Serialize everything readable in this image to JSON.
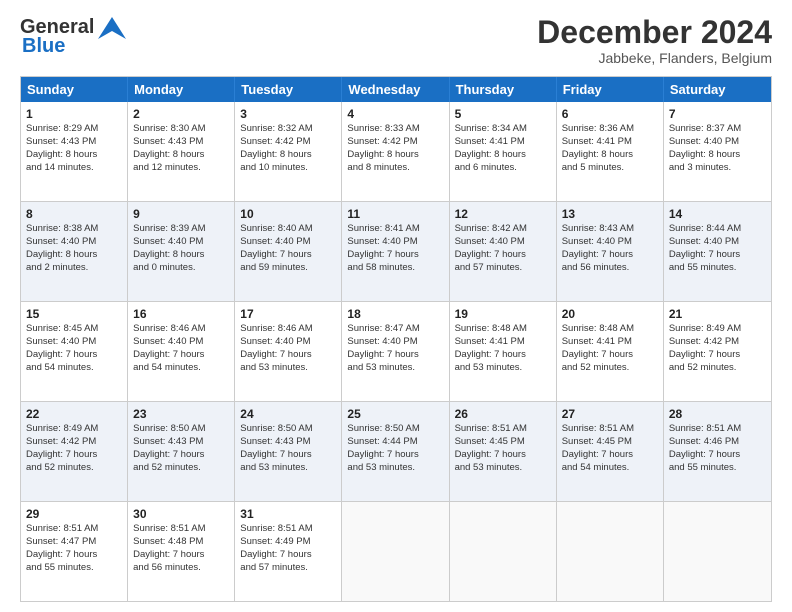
{
  "logo": {
    "line1": "General",
    "line2": "Blue"
  },
  "title": "December 2024",
  "subtitle": "Jabbeke, Flanders, Belgium",
  "days": [
    "Sunday",
    "Monday",
    "Tuesday",
    "Wednesday",
    "Thursday",
    "Friday",
    "Saturday"
  ],
  "weeks": [
    [
      {
        "num": "1",
        "lines": [
          "Sunrise: 8:29 AM",
          "Sunset: 4:43 PM",
          "Daylight: 8 hours",
          "and 14 minutes."
        ]
      },
      {
        "num": "2",
        "lines": [
          "Sunrise: 8:30 AM",
          "Sunset: 4:43 PM",
          "Daylight: 8 hours",
          "and 12 minutes."
        ]
      },
      {
        "num": "3",
        "lines": [
          "Sunrise: 8:32 AM",
          "Sunset: 4:42 PM",
          "Daylight: 8 hours",
          "and 10 minutes."
        ]
      },
      {
        "num": "4",
        "lines": [
          "Sunrise: 8:33 AM",
          "Sunset: 4:42 PM",
          "Daylight: 8 hours",
          "and 8 minutes."
        ]
      },
      {
        "num": "5",
        "lines": [
          "Sunrise: 8:34 AM",
          "Sunset: 4:41 PM",
          "Daylight: 8 hours",
          "and 6 minutes."
        ]
      },
      {
        "num": "6",
        "lines": [
          "Sunrise: 8:36 AM",
          "Sunset: 4:41 PM",
          "Daylight: 8 hours",
          "and 5 minutes."
        ]
      },
      {
        "num": "7",
        "lines": [
          "Sunrise: 8:37 AM",
          "Sunset: 4:40 PM",
          "Daylight: 8 hours",
          "and 3 minutes."
        ]
      }
    ],
    [
      {
        "num": "8",
        "lines": [
          "Sunrise: 8:38 AM",
          "Sunset: 4:40 PM",
          "Daylight: 8 hours",
          "and 2 minutes."
        ]
      },
      {
        "num": "9",
        "lines": [
          "Sunrise: 8:39 AM",
          "Sunset: 4:40 PM",
          "Daylight: 8 hours",
          "and 0 minutes."
        ]
      },
      {
        "num": "10",
        "lines": [
          "Sunrise: 8:40 AM",
          "Sunset: 4:40 PM",
          "Daylight: 7 hours",
          "and 59 minutes."
        ]
      },
      {
        "num": "11",
        "lines": [
          "Sunrise: 8:41 AM",
          "Sunset: 4:40 PM",
          "Daylight: 7 hours",
          "and 58 minutes."
        ]
      },
      {
        "num": "12",
        "lines": [
          "Sunrise: 8:42 AM",
          "Sunset: 4:40 PM",
          "Daylight: 7 hours",
          "and 57 minutes."
        ]
      },
      {
        "num": "13",
        "lines": [
          "Sunrise: 8:43 AM",
          "Sunset: 4:40 PM",
          "Daylight: 7 hours",
          "and 56 minutes."
        ]
      },
      {
        "num": "14",
        "lines": [
          "Sunrise: 8:44 AM",
          "Sunset: 4:40 PM",
          "Daylight: 7 hours",
          "and 55 minutes."
        ]
      }
    ],
    [
      {
        "num": "15",
        "lines": [
          "Sunrise: 8:45 AM",
          "Sunset: 4:40 PM",
          "Daylight: 7 hours",
          "and 54 minutes."
        ]
      },
      {
        "num": "16",
        "lines": [
          "Sunrise: 8:46 AM",
          "Sunset: 4:40 PM",
          "Daylight: 7 hours",
          "and 54 minutes."
        ]
      },
      {
        "num": "17",
        "lines": [
          "Sunrise: 8:46 AM",
          "Sunset: 4:40 PM",
          "Daylight: 7 hours",
          "and 53 minutes."
        ]
      },
      {
        "num": "18",
        "lines": [
          "Sunrise: 8:47 AM",
          "Sunset: 4:40 PM",
          "Daylight: 7 hours",
          "and 53 minutes."
        ]
      },
      {
        "num": "19",
        "lines": [
          "Sunrise: 8:48 AM",
          "Sunset: 4:41 PM",
          "Daylight: 7 hours",
          "and 53 minutes."
        ]
      },
      {
        "num": "20",
        "lines": [
          "Sunrise: 8:48 AM",
          "Sunset: 4:41 PM",
          "Daylight: 7 hours",
          "and 52 minutes."
        ]
      },
      {
        "num": "21",
        "lines": [
          "Sunrise: 8:49 AM",
          "Sunset: 4:42 PM",
          "Daylight: 7 hours",
          "and 52 minutes."
        ]
      }
    ],
    [
      {
        "num": "22",
        "lines": [
          "Sunrise: 8:49 AM",
          "Sunset: 4:42 PM",
          "Daylight: 7 hours",
          "and 52 minutes."
        ]
      },
      {
        "num": "23",
        "lines": [
          "Sunrise: 8:50 AM",
          "Sunset: 4:43 PM",
          "Daylight: 7 hours",
          "and 52 minutes."
        ]
      },
      {
        "num": "24",
        "lines": [
          "Sunrise: 8:50 AM",
          "Sunset: 4:43 PM",
          "Daylight: 7 hours",
          "and 53 minutes."
        ]
      },
      {
        "num": "25",
        "lines": [
          "Sunrise: 8:50 AM",
          "Sunset: 4:44 PM",
          "Daylight: 7 hours",
          "and 53 minutes."
        ]
      },
      {
        "num": "26",
        "lines": [
          "Sunrise: 8:51 AM",
          "Sunset: 4:45 PM",
          "Daylight: 7 hours",
          "and 53 minutes."
        ]
      },
      {
        "num": "27",
        "lines": [
          "Sunrise: 8:51 AM",
          "Sunset: 4:45 PM",
          "Daylight: 7 hours",
          "and 54 minutes."
        ]
      },
      {
        "num": "28",
        "lines": [
          "Sunrise: 8:51 AM",
          "Sunset: 4:46 PM",
          "Daylight: 7 hours",
          "and 55 minutes."
        ]
      }
    ],
    [
      {
        "num": "29",
        "lines": [
          "Sunrise: 8:51 AM",
          "Sunset: 4:47 PM",
          "Daylight: 7 hours",
          "and 55 minutes."
        ]
      },
      {
        "num": "30",
        "lines": [
          "Sunrise: 8:51 AM",
          "Sunset: 4:48 PM",
          "Daylight: 7 hours",
          "and 56 minutes."
        ]
      },
      {
        "num": "31",
        "lines": [
          "Sunrise: 8:51 AM",
          "Sunset: 4:49 PM",
          "Daylight: 7 hours",
          "and 57 minutes."
        ]
      },
      null,
      null,
      null,
      null
    ]
  ]
}
